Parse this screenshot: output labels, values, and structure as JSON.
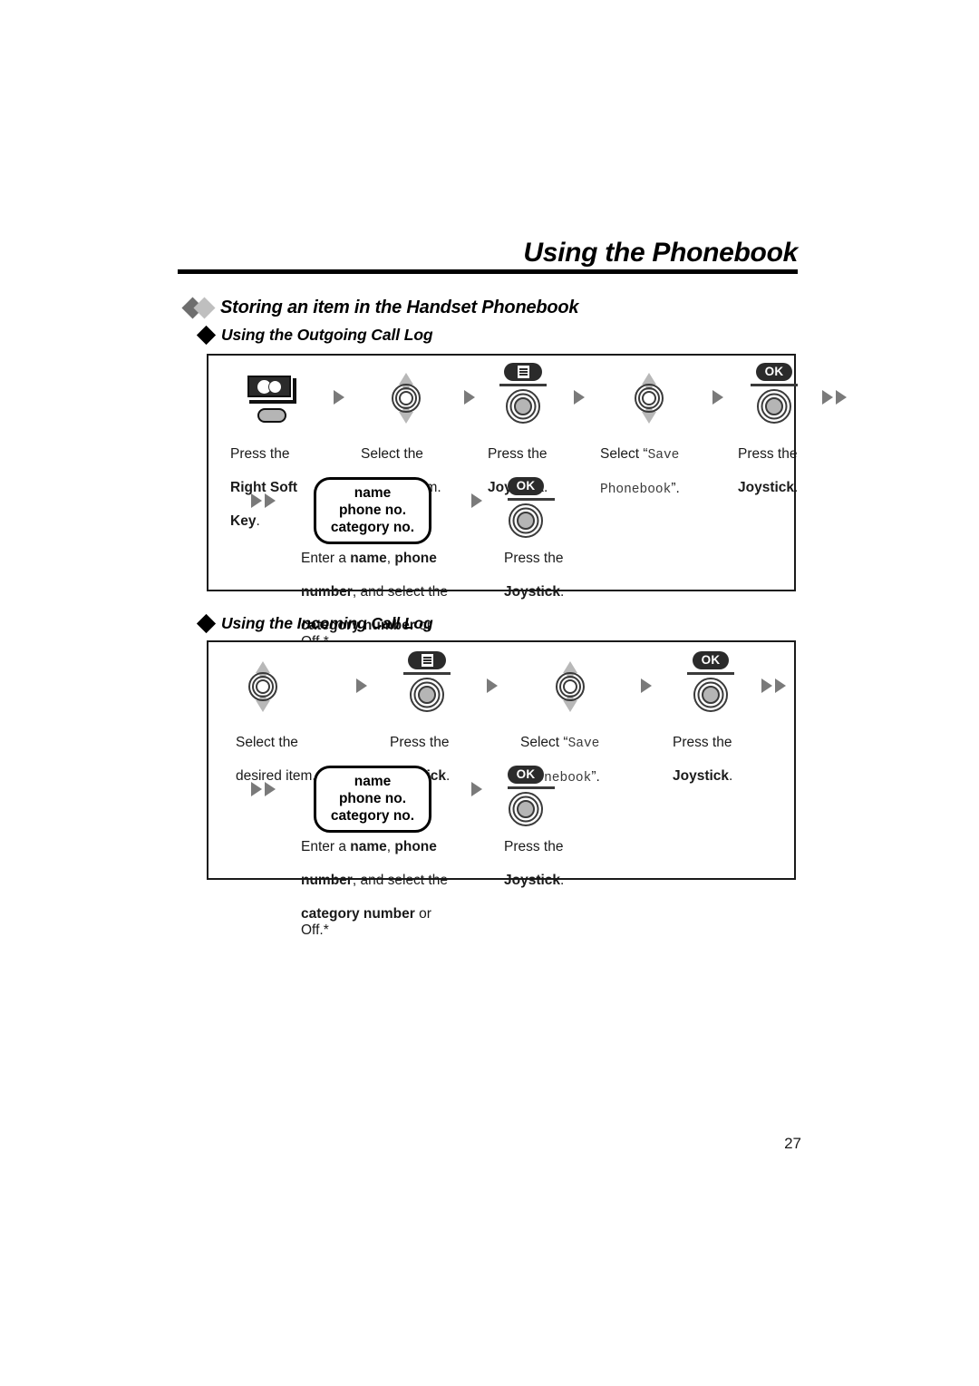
{
  "header": {
    "title": "Using the Phonebook"
  },
  "section": {
    "heading": "Storing an item in the Handset Phonebook"
  },
  "subsections": [
    {
      "heading": "Using the Outgoing Call Log",
      "row1": [
        {
          "icon": "right-soft-key-icon",
          "line1_plain": "Press the",
          "line2_bold": "Right Soft",
          "line3_bold": "Key",
          "line3_plain": "."
        },
        {
          "icon": "joystick-navigate-icon",
          "line1_plain": "Select the",
          "line2_plain": "desired item."
        },
        {
          "icon": "joystick-menu-press-icon",
          "line1_plain": "Press the",
          "line2_bold": "Joystick",
          "line2_plain": "."
        },
        {
          "icon": "joystick-navigate-icon",
          "line1_plain": "Select “",
          "line1_mono": "Save",
          "line2_mono": "Phonebook",
          "line2_plain": "”."
        },
        {
          "icon": "joystick-ok-press-icon",
          "line1_plain": "Press the",
          "line2_bold": "Joystick",
          "line2_plain": "."
        }
      ],
      "row2": [
        {
          "icon": "display-box",
          "display_lines": [
            "name",
            "phone no.",
            "category no."
          ],
          "cap_a1": "Enter a ",
          "cap_a2": "name",
          "cap_a3": ", ",
          "cap_a4": "phone",
          "cap_b1": "number",
          "cap_b2": ", and select the",
          "cap_c1": "category number",
          "cap_c2": " or Off.*"
        },
        {
          "icon": "joystick-ok-press-icon",
          "line1_plain": "Press the",
          "line2_bold": "Joystick",
          "line2_plain": "."
        }
      ]
    },
    {
      "heading": "Using the Incoming Call Log",
      "row1": [
        {
          "icon": "joystick-navigate-icon",
          "line1_plain": "Select the",
          "line2_plain": "desired item."
        },
        {
          "icon": "joystick-menu-press-icon",
          "line1_plain": "Press the",
          "line2_bold": "Joystick",
          "line2_plain": "."
        },
        {
          "icon": "joystick-navigate-icon",
          "line1_plain": "Select “",
          "line1_mono": "Save",
          "line2_mono": "Phonebook",
          "line2_plain": "”."
        },
        {
          "icon": "joystick-ok-press-icon",
          "line1_plain": "Press the",
          "line2_bold": "Joystick",
          "line2_plain": "."
        }
      ],
      "row2": [
        {
          "icon": "display-box",
          "display_lines": [
            "name",
            "phone no.",
            "category no."
          ],
          "cap_a1": "Enter a ",
          "cap_a2": "name",
          "cap_a3": ", ",
          "cap_a4": "phone",
          "cap_b1": "number",
          "cap_b2": ", and select the",
          "cap_c1": "category number",
          "cap_c2": " or Off.*"
        },
        {
          "icon": "joystick-ok-press-icon",
          "line1_plain": "Press the",
          "line2_bold": "Joystick",
          "line2_plain": "."
        }
      ]
    }
  ],
  "footer": {
    "page_number": "27"
  },
  "colors": {
    "ink": "#000000",
    "arrow_gray": "#7a7a7a",
    "diamond_dark": "#6e6e6e",
    "diamond_light": "#bfbfbf",
    "key_dark": "#2b2b2b"
  }
}
